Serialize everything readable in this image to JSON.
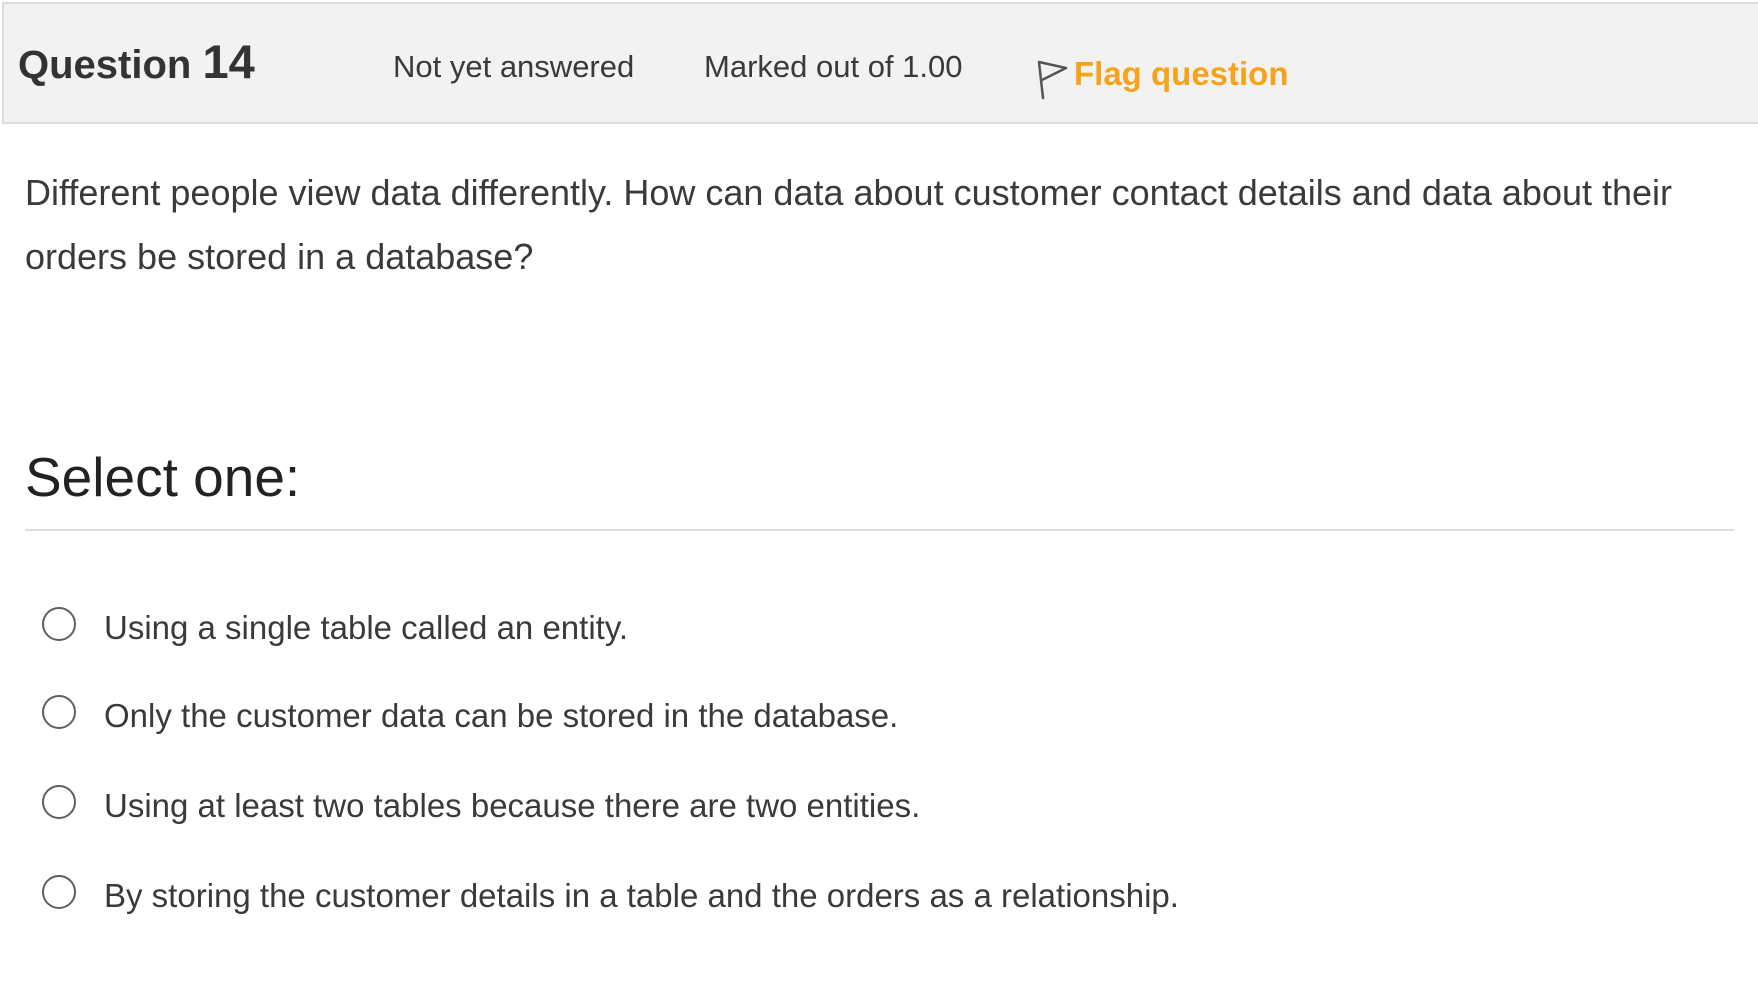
{
  "info": {
    "question_prefix": "Question",
    "question_number": "14",
    "state": "Not yet answered",
    "grade": "Marked out of 1.00",
    "flag_label": "Flag question",
    "flag_icon": "flag-outline-icon"
  },
  "question": {
    "text": "Different people view data differently. How can data about customer contact details and data about their orders be stored in a database?"
  },
  "answer": {
    "prompt": "Select one:",
    "options": [
      {
        "label": "Using a single table called an entity.",
        "selected": false
      },
      {
        "label": "Only the customer data can be stored in the database.",
        "selected": false
      },
      {
        "label": "Using at least two tables because there are two entities.",
        "selected": false
      },
      {
        "label": "By storing the customer details in a table and the orders as a relationship.",
        "selected": false
      }
    ]
  },
  "colors": {
    "info_bar_bg": "#f2f2f2",
    "flag_accent": "#f7a21b",
    "text": "#3a3a3a"
  }
}
